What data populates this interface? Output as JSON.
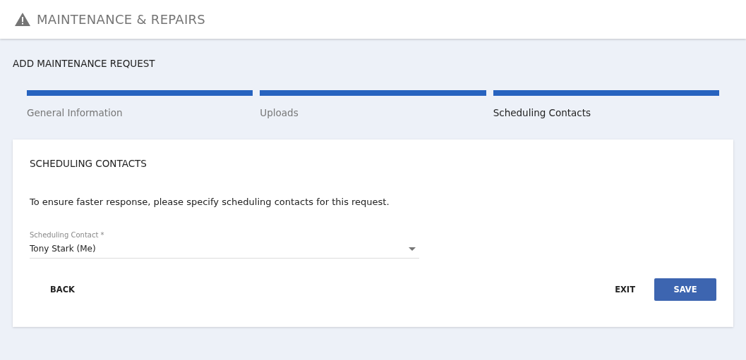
{
  "app_bar": {
    "title": "MAINTENANCE & REPAIRS"
  },
  "page_title": "ADD MAINTENANCE REQUEST",
  "steps": [
    {
      "label": "General Information",
      "completed": true,
      "selected": false
    },
    {
      "label": "Uploads",
      "completed": true,
      "selected": false
    },
    {
      "label": "Scheduling Contacts",
      "completed": true,
      "selected": true
    }
  ],
  "card": {
    "heading": "SCHEDULING CONTACTS",
    "description": "To ensure faster response, please specify scheduling contacts for this request.",
    "field": {
      "label": "Scheduling Contact *",
      "value": "Tony Stark (Me)"
    },
    "buttons": [
      {
        "label": "BACK",
        "kind": "text"
      },
      {
        "label": "EXIT",
        "kind": "text"
      },
      {
        "label": "SAVE",
        "kind": "primary"
      }
    ]
  }
}
